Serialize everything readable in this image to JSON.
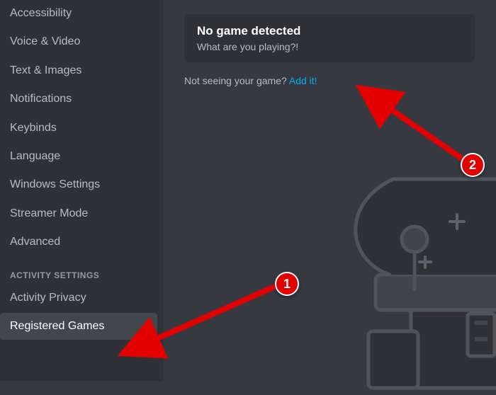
{
  "sidebar": {
    "items": [
      {
        "label": "Accessibility",
        "selected": false
      },
      {
        "label": "Voice & Video",
        "selected": false
      },
      {
        "label": "Text & Images",
        "selected": false
      },
      {
        "label": "Notifications",
        "selected": false
      },
      {
        "label": "Keybinds",
        "selected": false
      },
      {
        "label": "Language",
        "selected": false
      },
      {
        "label": "Windows Settings",
        "selected": false
      },
      {
        "label": "Streamer Mode",
        "selected": false
      },
      {
        "label": "Advanced",
        "selected": false
      }
    ],
    "activity_heading": "ACTIVITY SETTINGS",
    "activity_items": [
      {
        "label": "Activity Privacy",
        "selected": false
      },
      {
        "label": "Registered Games",
        "selected": true
      }
    ]
  },
  "main": {
    "card": {
      "title": "No game detected",
      "subtitle": "What are you playing?!"
    },
    "add_row": {
      "prefix": "Not seeing your game? ",
      "link": "Add it!"
    }
  },
  "annotations": {
    "callout1": "1",
    "callout2": "2"
  }
}
